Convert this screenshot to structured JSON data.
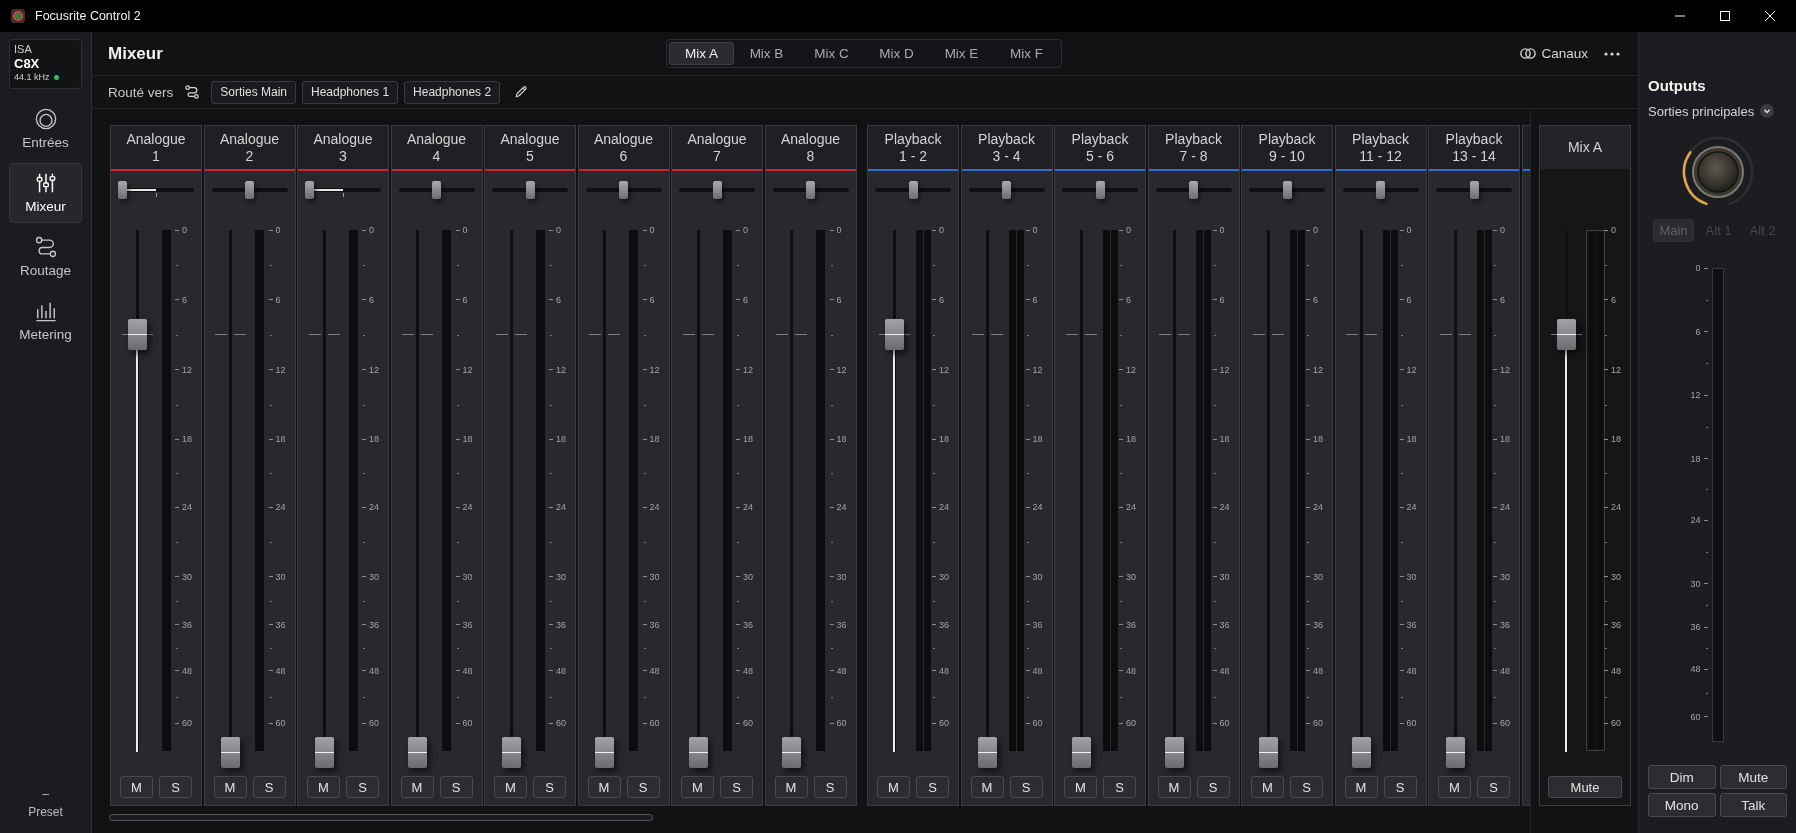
{
  "window": {
    "title": "Focusrite Control 2"
  },
  "device": {
    "brand": "ISA",
    "model": "C8X",
    "sample_rate": "44.1 kHz",
    "connected": true
  },
  "sidebar": {
    "items": [
      {
        "label": "Entrées",
        "selected": false
      },
      {
        "label": "Mixeur",
        "selected": true
      },
      {
        "label": "Routage",
        "selected": false
      },
      {
        "label": "Metering",
        "selected": false
      }
    ],
    "preset": {
      "value": "–",
      "label": "Preset"
    }
  },
  "header": {
    "title": "Mixeur",
    "mix_tabs": [
      {
        "label": "Mix A",
        "selected": true
      },
      {
        "label": "Mix B",
        "selected": false
      },
      {
        "label": "Mix C",
        "selected": false
      },
      {
        "label": "Mix D",
        "selected": false
      },
      {
        "label": "Mix E",
        "selected": false
      },
      {
        "label": "Mix F",
        "selected": false
      }
    ],
    "channels_button": "Canaux"
  },
  "routing": {
    "label": "Routé vers",
    "destinations": [
      "Sorties Main",
      "Headphones 1",
      "Headphones 2"
    ]
  },
  "channel_groups": [
    {
      "kind": "mono",
      "color": "#c8282f",
      "channels": [
        {
          "name_lines": [
            "Analogue",
            "1"
          ],
          "pan": {
            "level": 0
          },
          "fader": {
            "level": 0.8
          },
          "mute": {
            "label": "M",
            "on": false
          },
          "solo": {
            "label": "S",
            "on": false
          },
          "scale": [
            "0",
            "6",
            "12",
            "18",
            "24",
            "30",
            "36",
            "48",
            "60"
          ]
        },
        {
          "name_lines": [
            "Analogue",
            "2"
          ],
          "pan": {
            "level": 0.5
          },
          "fader": {
            "level": 0
          },
          "mute": {
            "label": "M",
            "on": false
          },
          "solo": {
            "label": "S",
            "on": false
          },
          "scale": [
            "0",
            "6",
            "12",
            "18",
            "24",
            "30",
            "36",
            "48",
            "60"
          ]
        },
        {
          "name_lines": [
            "Analogue",
            "3"
          ],
          "pan": {
            "level": 0
          },
          "fader": {
            "level": 0
          },
          "mute": {
            "label": "M",
            "on": false
          },
          "solo": {
            "label": "S",
            "on": false
          },
          "scale": [
            "0",
            "6",
            "12",
            "18",
            "24",
            "30",
            "36",
            "48",
            "60"
          ]
        },
        {
          "name_lines": [
            "Analogue",
            "4"
          ],
          "pan": {
            "level": 0.5
          },
          "fader": {
            "level": 0
          },
          "mute": {
            "label": "M",
            "on": false
          },
          "solo": {
            "label": "S",
            "on": false
          },
          "scale": [
            "0",
            "6",
            "12",
            "18",
            "24",
            "30",
            "36",
            "48",
            "60"
          ]
        },
        {
          "name_lines": [
            "Analogue",
            "5"
          ],
          "pan": {
            "level": 0.5
          },
          "fader": {
            "level": 0
          },
          "mute": {
            "label": "M",
            "on": false
          },
          "solo": {
            "label": "S",
            "on": false
          },
          "scale": [
            "0",
            "6",
            "12",
            "18",
            "24",
            "30",
            "36",
            "48",
            "60"
          ]
        },
        {
          "name_lines": [
            "Analogue",
            "6"
          ],
          "pan": {
            "level": 0.5
          },
          "fader": {
            "level": 0
          },
          "mute": {
            "label": "M",
            "on": false
          },
          "solo": {
            "label": "S",
            "on": false
          },
          "scale": [
            "0",
            "6",
            "12",
            "18",
            "24",
            "30",
            "36",
            "48",
            "60"
          ]
        },
        {
          "name_lines": [
            "Analogue",
            "7"
          ],
          "pan": {
            "level": 0.5
          },
          "fader": {
            "level": 0
          },
          "mute": {
            "label": "M",
            "on": false
          },
          "solo": {
            "label": "S",
            "on": false
          },
          "scale": [
            "0",
            "6",
            "12",
            "18",
            "24",
            "30",
            "36",
            "48",
            "60"
          ]
        },
        {
          "name_lines": [
            "Analogue",
            "8"
          ],
          "pan": {
            "level": 0.5
          },
          "fader": {
            "level": 0
          },
          "mute": {
            "label": "M",
            "on": false
          },
          "solo": {
            "label": "S",
            "on": false
          },
          "scale": [
            "0",
            "6",
            "12",
            "18",
            "24",
            "30",
            "36",
            "48",
            "60"
          ]
        }
      ]
    },
    {
      "kind": "stereo",
      "color": "#2f6fd2",
      "channels": [
        {
          "name_lines": [
            "Playback",
            "1 - 2"
          ],
          "pan": {
            "level": 0.5
          },
          "fader": {
            "level": 0.8
          },
          "mute": {
            "label": "M",
            "on": false
          },
          "solo": {
            "label": "S",
            "on": false
          },
          "scale": [
            "0",
            "6",
            "12",
            "18",
            "24",
            "30",
            "36",
            "48",
            "60"
          ]
        },
        {
          "name_lines": [
            "Playback",
            "3 - 4"
          ],
          "pan": {
            "level": 0.5
          },
          "fader": {
            "level": 0
          },
          "mute": {
            "label": "M",
            "on": false
          },
          "solo": {
            "label": "S",
            "on": false
          },
          "scale": [
            "0",
            "6",
            "12",
            "18",
            "24",
            "30",
            "36",
            "48",
            "60"
          ]
        },
        {
          "name_lines": [
            "Playback",
            "5 - 6"
          ],
          "pan": {
            "level": 0.5
          },
          "fader": {
            "level": 0
          },
          "mute": {
            "label": "M",
            "on": false
          },
          "solo": {
            "label": "S",
            "on": false
          },
          "scale": [
            "0",
            "6",
            "12",
            "18",
            "24",
            "30",
            "36",
            "48",
            "60"
          ]
        },
        {
          "name_lines": [
            "Playback",
            "7 - 8"
          ],
          "pan": {
            "level": 0.5
          },
          "fader": {
            "level": 0
          },
          "mute": {
            "label": "M",
            "on": false
          },
          "solo": {
            "label": "S",
            "on": false
          },
          "scale": [
            "0",
            "6",
            "12",
            "18",
            "24",
            "30",
            "36",
            "48",
            "60"
          ]
        },
        {
          "name_lines": [
            "Playback",
            "9 - 10"
          ],
          "pan": {
            "level": 0.5
          },
          "fader": {
            "level": 0
          },
          "mute": {
            "label": "M",
            "on": false
          },
          "solo": {
            "label": "S",
            "on": false
          },
          "scale": [
            "0",
            "6",
            "12",
            "18",
            "24",
            "30",
            "36",
            "48",
            "60"
          ]
        },
        {
          "name_lines": [
            "Playback",
            "11 - 12"
          ],
          "pan": {
            "level": 0.5
          },
          "fader": {
            "level": 0
          },
          "mute": {
            "label": "M",
            "on": false
          },
          "solo": {
            "label": "S",
            "on": false
          },
          "scale": [
            "0",
            "6",
            "12",
            "18",
            "24",
            "30",
            "36",
            "48",
            "60"
          ]
        },
        {
          "name_lines": [
            "Playback",
            "13 - 14"
          ],
          "pan": {
            "level": 0.5
          },
          "fader": {
            "level": 0
          },
          "mute": {
            "label": "M",
            "on": false
          },
          "solo": {
            "label": "S",
            "on": false
          },
          "scale": [
            "0",
            "6",
            "12",
            "18",
            "24",
            "30",
            "36",
            "48",
            "60"
          ]
        }
      ]
    }
  ],
  "mix_bus": {
    "label": "Mix A",
    "fader": {
      "level": 0.8
    },
    "scale": [
      "0",
      "6",
      "12",
      "18",
      "24",
      "30",
      "36",
      "48",
      "60"
    ],
    "mute": {
      "label": "Mute",
      "on": false
    }
  },
  "outputs": {
    "title": "Outputs",
    "selector": "Sorties principales",
    "knob": {
      "level": 0.33
    },
    "speaker_sets": [
      {
        "label": "Main",
        "selected": true,
        "disabled": true
      },
      {
        "label": "Alt 1",
        "selected": false,
        "disabled": true
      },
      {
        "label": "Alt 2",
        "selected": false,
        "disabled": true
      }
    ],
    "scale": [
      "0",
      "6",
      "12",
      "18",
      "24",
      "30",
      "36",
      "48",
      "60"
    ],
    "buttons": [
      {
        "label": "Dim",
        "on": false
      },
      {
        "label": "Mute",
        "on": false
      },
      {
        "label": "Mono",
        "on": false
      },
      {
        "label": "Talk",
        "on": false
      }
    ]
  }
}
